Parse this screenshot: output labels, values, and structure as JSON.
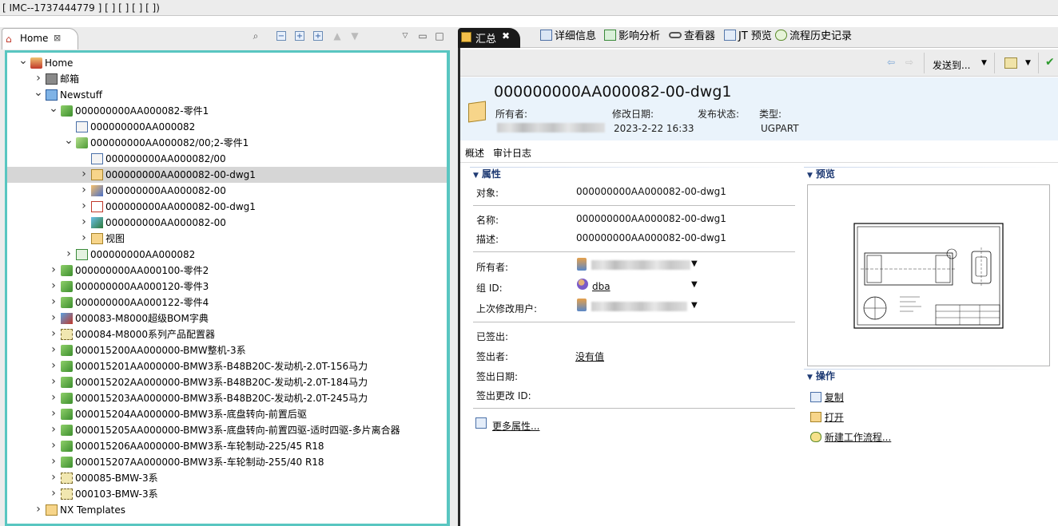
{
  "window": {
    "title": "[ IMC--1737444779 ] [  ] [ ] [  ]  [  ])"
  },
  "left_panel": {
    "tab_label": "Home",
    "tab_close": "⊠",
    "toolbar_icons": [
      "search-icon",
      "collapse-all-icon",
      "expand-icon",
      "expand-all-icon",
      "up-arrow-icon",
      "down-arrow-icon",
      "view-menu-icon",
      "minimize-icon",
      "maximize-icon"
    ]
  },
  "tree": [
    {
      "label": "Home",
      "level": 0,
      "state": "expanded",
      "icon": "home-icon"
    },
    {
      "label": "邮箱",
      "level": 1,
      "state": "collapsed",
      "icon": "mailbox-icon"
    },
    {
      "label": "Newstuff",
      "level": 1,
      "state": "expanded",
      "icon": "newstuff-folder-icon"
    },
    {
      "label": "000000000AA000082-零件1",
      "level": 2,
      "state": "expanded",
      "icon": "item-icon"
    },
    {
      "label": "000000000AA000082",
      "level": 3,
      "state": "leaf",
      "icon": "form-icon"
    },
    {
      "label": "000000000AA000082/00;2-零件1",
      "level": 3,
      "state": "expanded",
      "icon": "item-revision-icon"
    },
    {
      "label": "000000000AA000082/00",
      "level": 4,
      "state": "leaf",
      "icon": "form-icon"
    },
    {
      "label": "000000000AA000082-00-dwg1",
      "level": 4,
      "state": "collapsed",
      "icon": "ugpart-icon",
      "selected": true
    },
    {
      "label": "000000000AA000082-00",
      "level": 4,
      "state": "collapsed",
      "icon": "ugmaster-icon"
    },
    {
      "label": "000000000AA000082-00-dwg1",
      "level": 4,
      "state": "collapsed",
      "icon": "pdf-icon"
    },
    {
      "label": "000000000AA000082-00",
      "level": 4,
      "state": "collapsed",
      "icon": "jt-icon"
    },
    {
      "label": "视图",
      "level": 4,
      "state": "collapsed",
      "icon": "view-folder-icon"
    },
    {
      "label": "000000000AA000082",
      "level": 3,
      "state": "collapsed",
      "icon": "bom-view-icon"
    },
    {
      "label": "000000000AA000100-零件2",
      "level": 2,
      "state": "collapsed",
      "icon": "item-icon"
    },
    {
      "label": "000000000AA000120-零件3",
      "level": 2,
      "state": "collapsed",
      "icon": "item-icon"
    },
    {
      "label": "000000000AA000122-零件4",
      "level": 2,
      "state": "collapsed",
      "icon": "item-icon"
    },
    {
      "label": "000083-M8000超级BOM字典",
      "level": 2,
      "state": "collapsed",
      "icon": "dictionary-icon"
    },
    {
      "label": "000084-M8000系列产品配置器",
      "level": 2,
      "state": "collapsed",
      "icon": "configurator-icon"
    },
    {
      "label": "000015200AA000000-BMW整机-3系",
      "level": 2,
      "state": "collapsed",
      "icon": "item-icon"
    },
    {
      "label": "000015201AA000000-BMW3系-B48B20C-发动机-2.0T-156马力",
      "level": 2,
      "state": "collapsed",
      "icon": "item-icon"
    },
    {
      "label": "000015202AA000000-BMW3系-B48B20C-发动机-2.0T-184马力",
      "level": 2,
      "state": "collapsed",
      "icon": "item-icon"
    },
    {
      "label": "000015203AA000000-BMW3系-B48B20C-发动机-2.0T-245马力",
      "level": 2,
      "state": "collapsed",
      "icon": "item-icon"
    },
    {
      "label": "000015204AA000000-BMW3系-底盘转向-前置后驱",
      "level": 2,
      "state": "collapsed",
      "icon": "item-icon"
    },
    {
      "label": "000015205AA000000-BMW3系-底盘转向-前置四驱-适时四驱-多片离合器",
      "level": 2,
      "state": "collapsed",
      "icon": "item-icon"
    },
    {
      "label": "000015206AA000000-BMW3系-车轮制动-225/45 R18",
      "level": 2,
      "state": "collapsed",
      "icon": "item-icon"
    },
    {
      "label": "000015207AA000000-BMW3系-车轮制动-255/40 R18",
      "level": 2,
      "state": "collapsed",
      "icon": "item-icon"
    },
    {
      "label": "000085-BMW-3系",
      "level": 2,
      "state": "collapsed",
      "icon": "configurator-icon"
    },
    {
      "label": "000103-BMW-3系",
      "level": 2,
      "state": "collapsed",
      "icon": "configurator-icon"
    },
    {
      "label": "NX Templates",
      "level": 1,
      "state": "collapsed",
      "icon": "folder-icon"
    }
  ],
  "right_tabs": [
    {
      "label": "汇总",
      "active": true,
      "close": "✖"
    },
    {
      "label": "详细信息",
      "active": false
    },
    {
      "label": "影响分析",
      "active": false
    },
    {
      "label": "查看器",
      "active": false
    },
    {
      "label": "JT 预览",
      "active": false
    },
    {
      "label": "流程历史记录",
      "active": false
    }
  ],
  "toolbar": {
    "send_to": "发送到..."
  },
  "object": {
    "title": "000000000AA000082-00-dwg1",
    "owner_label": "所有者:",
    "modified_label": "修改日期:",
    "modified_value": "2023-2-22 16:33",
    "release_label": "发布状态:",
    "release_value": "",
    "type_label": "类型:",
    "type_value": "UGPART"
  },
  "sub_tabs": [
    "概述",
    "审计日志"
  ],
  "properties": {
    "header": "属性",
    "object_label": "对象:",
    "object_value": "000000000AA000082-00-dwg1",
    "name_label": "名称:",
    "name_value": "000000000AA000082-00-dwg1",
    "desc_label": "描述:",
    "desc_value": "000000000AA000082-00-dwg1",
    "owner_label": "所有者:",
    "group_label": "组 ID:",
    "group_value": "dba",
    "last_mod_label": "上次修改用户:",
    "checked_out_label": "已签出:",
    "checked_out_by_label": "签出者:",
    "checked_out_by_value": "没有值",
    "checkout_date_label": "签出日期:",
    "checkout_change_label": "签出更改 ID:",
    "more_props": "更多属性..."
  },
  "preview": {
    "header": "预览"
  },
  "actions": {
    "header": "操作",
    "copy": "复制",
    "open": "打开",
    "new_workflow": "新建工作流程..."
  },
  "colors": {
    "accent_border": "#59c6c1",
    "section_header": "#1f3b74",
    "object_header_bg": "#eaf3fb",
    "selection": "#d6d6d6"
  }
}
